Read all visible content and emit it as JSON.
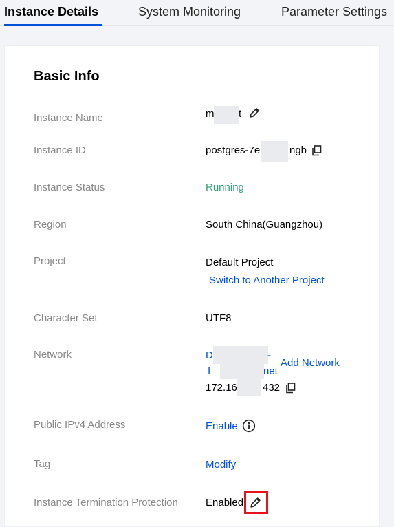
{
  "tabs": [
    {
      "label": "Instance Details",
      "active": true
    },
    {
      "label": "System Monitoring",
      "active": false
    },
    {
      "label": "Parameter Settings",
      "active": false
    }
  ],
  "basic_info": {
    "title": "Basic Info",
    "instance_name": {
      "label": "Instance Name",
      "value_start": "m",
      "value_end": "t"
    },
    "instance_id": {
      "label": "Instance ID",
      "value_start": "postgres-7e",
      "value_end": "ngb"
    },
    "instance_status": {
      "label": "Instance Status",
      "value": "Running"
    },
    "region": {
      "label": "Region",
      "value": "South China(Guangzhou)"
    },
    "project": {
      "label": "Project",
      "value": "Default Project",
      "switch_link": "Switch to Another Project"
    },
    "character_set": {
      "label": "Character Set",
      "value": "UTF8"
    },
    "network": {
      "label": "Network",
      "vpc_prefix": "D",
      "vpc_suffix": "-",
      "subnet_prefix": "I",
      "subnet_suffix": "net",
      "add_link": "Add Network",
      "ip_start": "172.16",
      "ip_end": "432"
    },
    "public_ipv4": {
      "label": "Public IPv4 Address",
      "action": "Enable"
    },
    "tag": {
      "label": "Tag",
      "action": "Modify"
    },
    "termination_protection": {
      "label": "Instance Termination Protection",
      "value": "Enabled"
    }
  },
  "colors": {
    "accent": "#0052d9",
    "running": "#2ba471",
    "highlight": "#e8121b"
  },
  "icons": [
    "edit-icon",
    "copy-icon",
    "info-icon"
  ]
}
